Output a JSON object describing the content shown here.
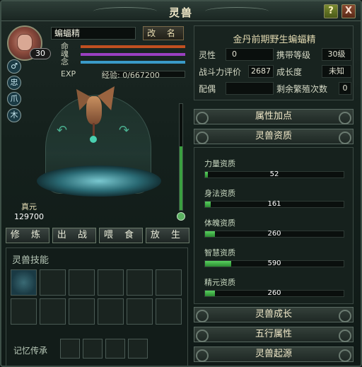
{
  "window": {
    "title": "灵兽",
    "help_label": "?",
    "close_label": "X"
  },
  "beast": {
    "name": "蝙蝠精",
    "level": "30",
    "rename_label": "改 名",
    "full_title": "金丹前期野生蝙蝠精",
    "bars": [
      {
        "label": "命",
        "color": "#c05020"
      },
      {
        "label": "魂",
        "color": "#9a40c0"
      },
      {
        "label": "念",
        "color": "#3a9ac8"
      }
    ],
    "exp_label": "EXP",
    "exp_text": "经验: 0/667200",
    "exp_fraction": 0,
    "side_icons": [
      "♂",
      "忠",
      "爪",
      "木"
    ]
  },
  "stats": {
    "rows": [
      [
        {
          "k": "灵性",
          "v": "0"
        },
        {
          "k": "携带等级",
          "v": "30级"
        }
      ],
      [
        {
          "k": "战斗力评价",
          "v": "2687"
        },
        {
          "k": "成长度",
          "v": "未知"
        }
      ],
      [
        {
          "k": "配偶",
          "v": ""
        },
        {
          "k": "剩余繁殖次数",
          "v": "0"
        }
      ]
    ]
  },
  "zhenyuan": {
    "label": "真元",
    "value": "129700"
  },
  "vertical_gauge_fraction": 0.6,
  "actions": [
    "修 炼",
    "出 战",
    "喂 食",
    "放 生"
  ],
  "skills": {
    "title": "灵兽技能",
    "memory_label": "记忆传承"
  },
  "accordion": {
    "attr_add": "属性加点",
    "qualities": "灵兽资质",
    "growth": "灵兽成长",
    "elements": "五行属性",
    "origin": "灵兽起源"
  },
  "qualities": [
    {
      "name": "力量资质",
      "value": "52",
      "fraction": 0.0
    },
    {
      "name": "身法资质",
      "value": "161",
      "fraction": 0.04
    },
    {
      "name": "体魄资质",
      "value": "260",
      "fraction": 0.07
    },
    {
      "name": "智慧资质",
      "value": "590",
      "fraction": 0.19
    },
    {
      "name": "精元资质",
      "value": "260",
      "fraction": 0.07
    }
  ],
  "colors": {
    "accent_green": "#3aa040",
    "title_gold": "#f0e8c8"
  }
}
